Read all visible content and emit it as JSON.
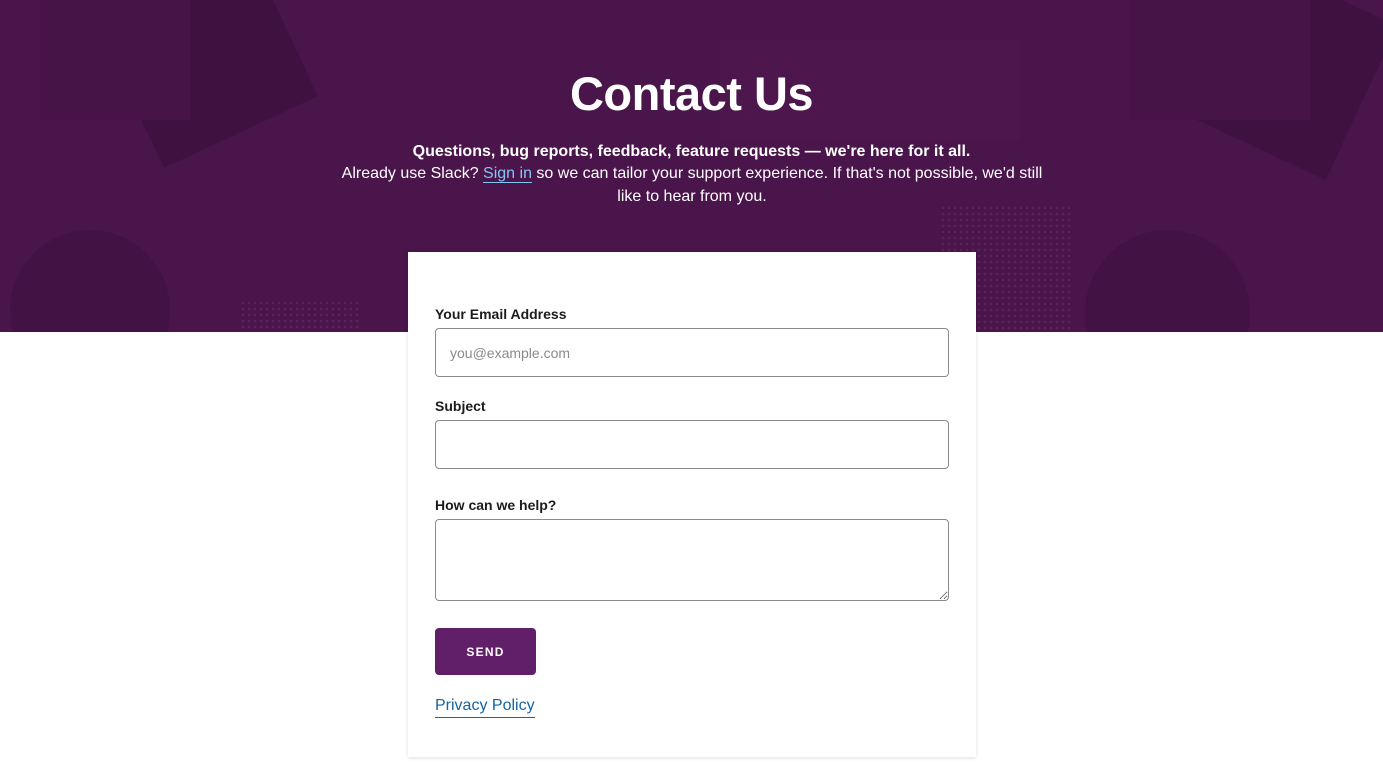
{
  "hero": {
    "title": "Contact Us",
    "lead": "Questions, bug reports, feedback, feature requests — we're here for it all.",
    "sub_before_link": "Already use Slack? ",
    "sign_in_label": "Sign in",
    "sub_after_link": " so we can tailor your support experience. If that's not possible, we'd still like to hear from you."
  },
  "form": {
    "email_label": "Your Email Address",
    "email_placeholder": "you@example.com",
    "email_value": "",
    "subject_label": "Subject",
    "subject_value": "",
    "help_label": "How can we help?",
    "help_value": "",
    "send_label": "SEND",
    "privacy_label": "Privacy Policy"
  },
  "colors": {
    "hero_background": "#4a154b",
    "button_background": "#611f69",
    "hero_link": "#7fc6f3",
    "privacy_link": "#1264a3"
  }
}
